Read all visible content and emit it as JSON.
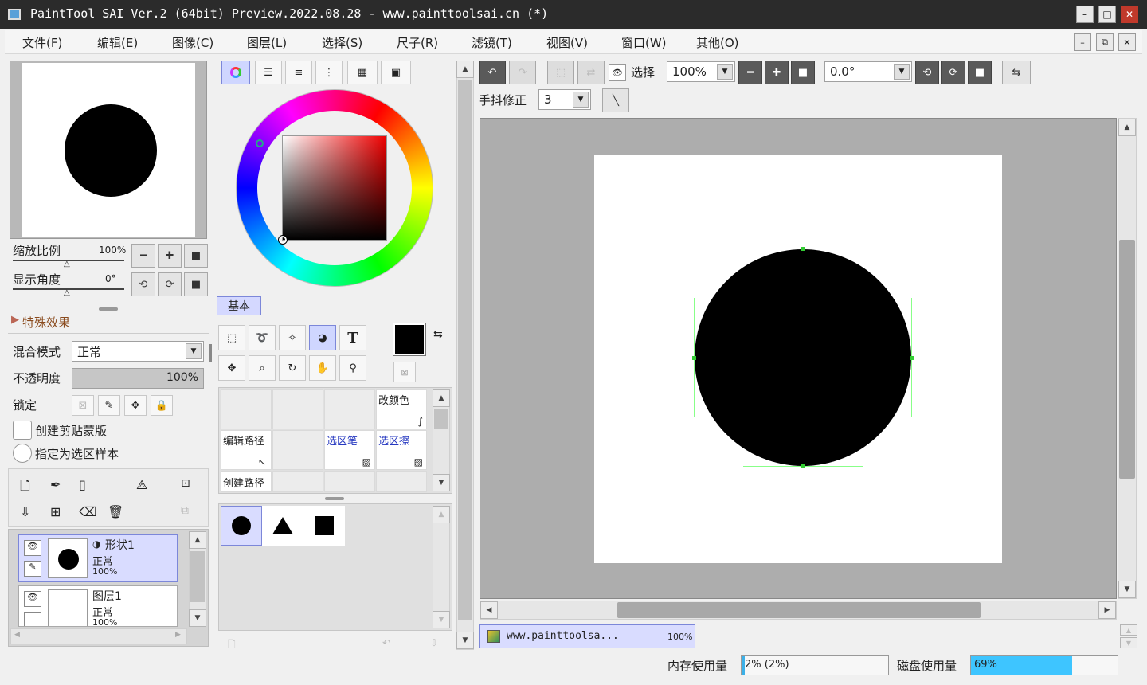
{
  "window": {
    "title": "PaintTool SAI Ver.2 (64bit) Preview.2022.08.28 - www.painttoolsai.cn (*)",
    "controls": {
      "minimize": "–",
      "maximize": "□",
      "close": "✕"
    }
  },
  "menu": [
    {
      "label": "文件(F)"
    },
    {
      "label": "编辑(E)"
    },
    {
      "label": "图像(C)"
    },
    {
      "label": "图层(L)"
    },
    {
      "label": "选择(S)"
    },
    {
      "label": "尺子(R)"
    },
    {
      "label": "滤镜(T)"
    },
    {
      "label": "视图(V)"
    },
    {
      "label": "窗口(W)"
    },
    {
      "label": "其他(O)"
    }
  ],
  "navigator": {
    "zoom_label": "缩放比例",
    "zoom_value": "100%",
    "angle_label": "显示角度",
    "angle_value": "0°"
  },
  "effects": {
    "title": "特殊效果"
  },
  "layer_props": {
    "blend_label": "混合模式",
    "blend_value": "正常",
    "opacity_label": "不透明度",
    "opacity_value": "100%",
    "lock_label": "锁定",
    "clip_label": "创建剪贴蒙版",
    "sample_label": "指定为选区样本"
  },
  "layers": [
    {
      "name": "形状1",
      "mode": "正常",
      "opacity": "100%"
    },
    {
      "name": "图层1",
      "mode": "正常",
      "opacity": "100%"
    }
  ],
  "color": {
    "primary": "#000000",
    "secondary": "#ffffff",
    "base_tab": "基本"
  },
  "tools": {
    "text_tool": "T",
    "grid": [
      {
        "label": "改颜色"
      },
      {
        "label": "编辑路径"
      },
      {
        "label": "选区笔"
      },
      {
        "label": "选区擦"
      },
      {
        "label": "创建路径"
      }
    ]
  },
  "toolbar": {
    "select_label": "选择",
    "zoom_value": "100%",
    "angle_value": "0.0°",
    "stabilizer_label": "手抖修正",
    "stabilizer_value": "3"
  },
  "document_tab": {
    "name": "www.painttoolsa...",
    "zoom": "100%"
  },
  "status": {
    "memory_label": "内存使用量",
    "memory_value": "2% (2%)",
    "memory_fraction": 0.02,
    "disk_label": "磁盘使用量",
    "disk_value": "69%",
    "disk_fraction": 0.69
  }
}
